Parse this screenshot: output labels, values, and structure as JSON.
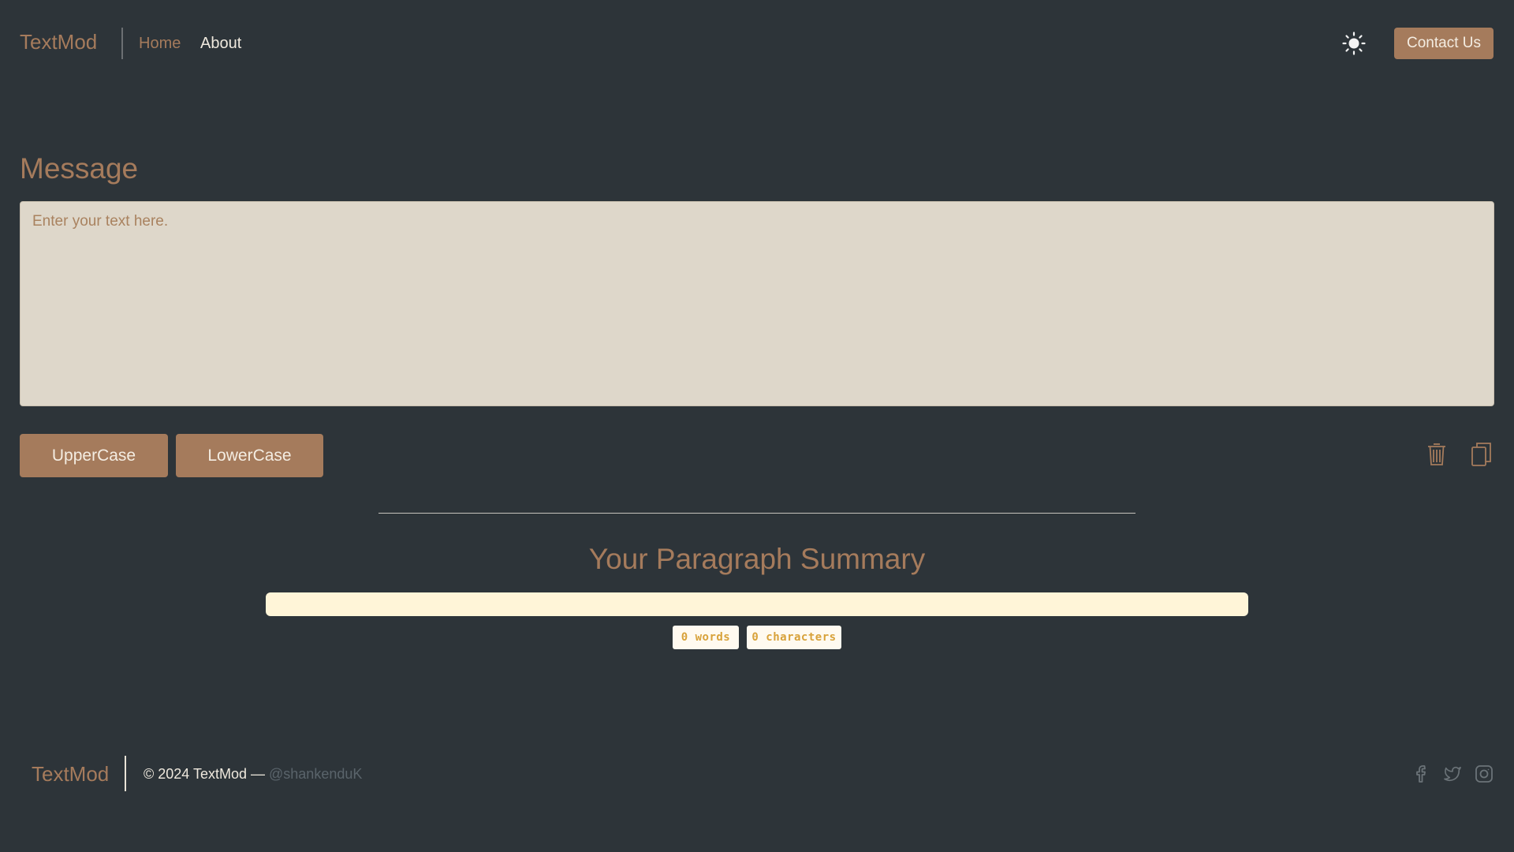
{
  "navbar": {
    "brand": "TextMod",
    "links": [
      {
        "label": "Home",
        "active": true
      },
      {
        "label": "About",
        "active": false
      }
    ],
    "theme_icon": "sun-icon",
    "contact_label": "Contact Us"
  },
  "form": {
    "heading": "Message",
    "textarea_value": "",
    "textarea_placeholder": "Enter your text here.",
    "buttons": {
      "uppercase": "UpperCase",
      "lowercase": "LowerCase"
    },
    "icons": [
      "trash-icon",
      "copy-icon"
    ]
  },
  "summary": {
    "heading": "Your Paragraph Summary",
    "words_badge": "0 words",
    "characters_badge": "0 characters"
  },
  "footer": {
    "brand": "TextMod",
    "copyright": "© 2024 TextMod — ",
    "handle": "@shankenduK",
    "social_icons": [
      "facebook-icon",
      "twitter-icon",
      "instagram-icon"
    ]
  },
  "colors": {
    "background": "#2d3439",
    "accent": "#a57b5c",
    "textarea_bg": "#ded7ca",
    "summary_bar_bg": "#fff5d8",
    "badge_text": "#d8a23a"
  }
}
